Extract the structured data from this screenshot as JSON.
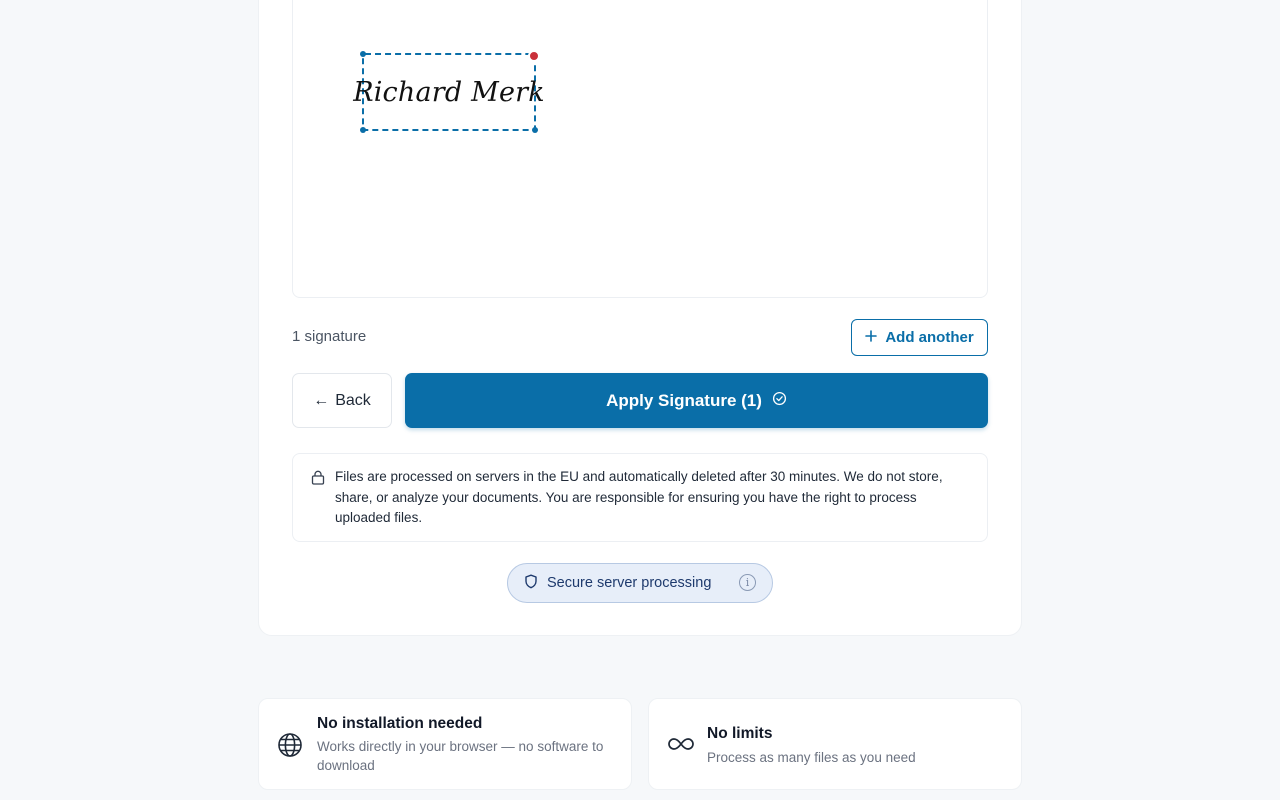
{
  "colors": {
    "primary": "#0a6ea8",
    "danger": "#c9303a",
    "pill_bg": "#e7eef9",
    "pill_text": "#1e3a6d"
  },
  "preview": {
    "signature_text": "Richard Merk",
    "delete_icon": "close-icon"
  },
  "signatures": {
    "count_label": "1 signature",
    "add_icon": "plus-icon",
    "add_label": "Add another"
  },
  "actions": {
    "back_arrow": "←",
    "back_label": "Back",
    "apply_label": "Apply Signature (1)",
    "apply_icon": "check-circle-icon"
  },
  "notice": {
    "icon": "lock-icon",
    "text": "Files are processed on servers in the EU and automatically deleted after 30 minutes. We do not store, share, or analyze your documents. You are responsible for ensuring you have the right to process uploaded files."
  },
  "secure_badge": {
    "icon": "shield-icon",
    "label": "Secure server processing",
    "info_icon": "info-icon",
    "info_glyph": "i"
  },
  "features": [
    {
      "icon": "globe-icon",
      "title": "No installation needed",
      "description": "Works directly in your browser — no software to download"
    },
    {
      "icon": "infinity-icon",
      "title": "No limits",
      "description": "Process as many files as you need"
    }
  ]
}
